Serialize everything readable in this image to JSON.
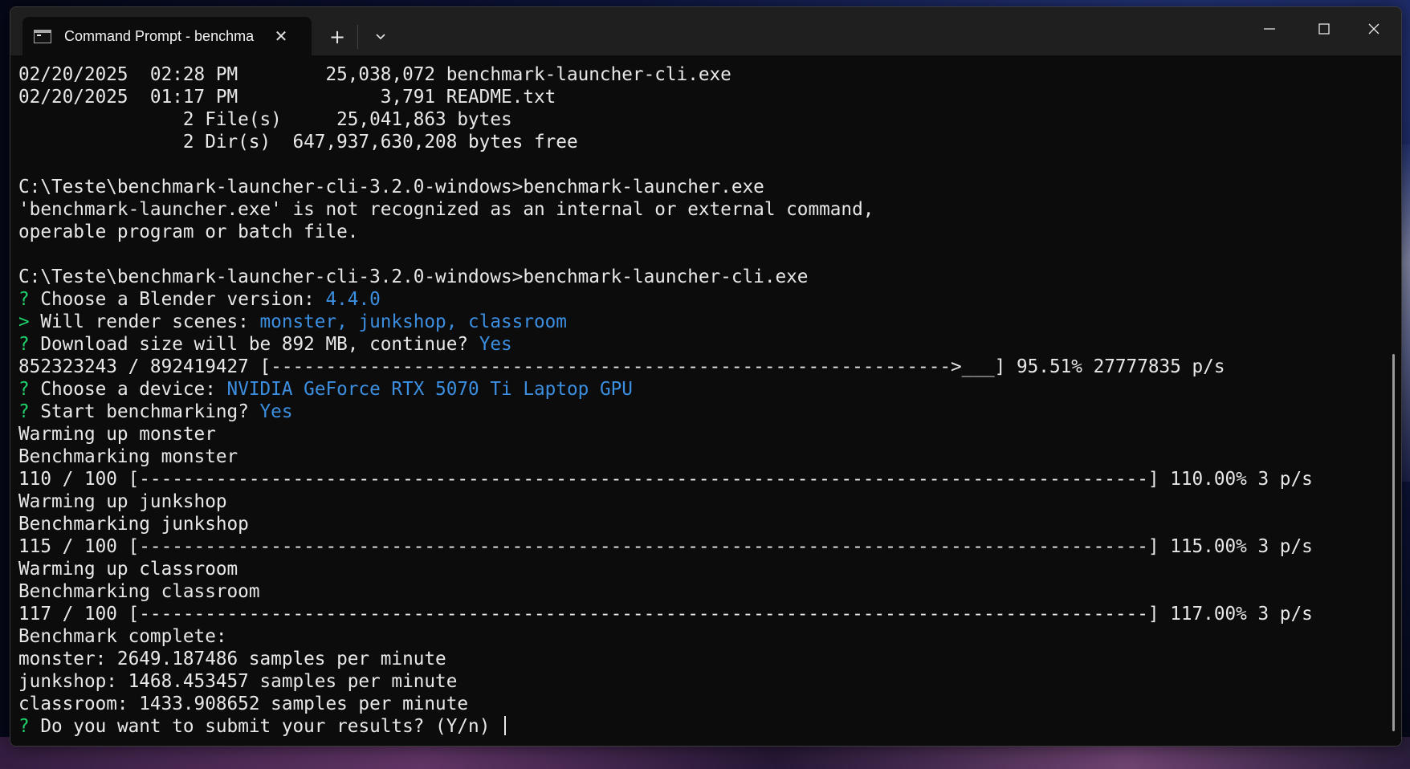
{
  "window": {
    "tab_title": "Command Prompt - benchma",
    "tab_icon": "terminal-icon",
    "close_tab_symbol": "✕",
    "new_tab_symbol": "+",
    "controls": [
      "minimize-icon",
      "maximize-icon",
      "close-icon"
    ]
  },
  "colors": {
    "prompt_green": "#1fd36a",
    "answer_blue": "#3c8fe0",
    "text": "#e8e8e8",
    "background": "#0c0c0c"
  },
  "terminal": {
    "lines": [
      {
        "t": "02/20/2025  02:28 PM        25,038,072 benchmark-launcher-cli.exe"
      },
      {
        "t": "02/20/2025  01:17 PM             3,791 README.txt"
      },
      {
        "t": "               2 File(s)     25,041,863 bytes"
      },
      {
        "t": "               2 Dir(s)  647,937,630,208 bytes free"
      },
      {
        "t": ""
      },
      {
        "t": "C:\\Teste\\benchmark-launcher-cli-3.2.0-windows>benchmark-launcher.exe"
      },
      {
        "t": "'benchmark-launcher.exe' is not recognized as an internal or external command,"
      },
      {
        "t": "operable program or batch file."
      },
      {
        "t": ""
      },
      {
        "t": "C:\\Teste\\benchmark-launcher-cli-3.2.0-windows>benchmark-launcher-cli.exe"
      },
      {
        "p": "?",
        "t": " Choose a Blender version: ",
        "a": "4.4.0"
      },
      {
        "p": ">",
        "t": " Will render scenes: ",
        "a": "monster, junkshop, classroom"
      },
      {
        "p": "?",
        "t": " Download size will be 892 MB, continue? ",
        "a": "Yes"
      },
      {
        "t": "852323243 / 892419427 [-------------------------------------------------------------->___] 95.51% 27777835 p/s"
      },
      {
        "p": "?",
        "t": " Choose a device: ",
        "a": "NVIDIA GeForce RTX 5070 Ti Laptop GPU"
      },
      {
        "p": "?",
        "t": " Start benchmarking? ",
        "a": "Yes"
      },
      {
        "t": "Warming up monster"
      },
      {
        "t": "Benchmarking monster"
      },
      {
        "t": "110 / 100 [--------------------------------------------------------------------------------------------] 110.00% 3 p/s"
      },
      {
        "t": "Warming up junkshop"
      },
      {
        "t": "Benchmarking junkshop"
      },
      {
        "t": "115 / 100 [--------------------------------------------------------------------------------------------] 115.00% 3 p/s"
      },
      {
        "t": "Warming up classroom"
      },
      {
        "t": "Benchmarking classroom"
      },
      {
        "t": "117 / 100 [--------------------------------------------------------------------------------------------] 117.00% 3 p/s"
      },
      {
        "t": "Benchmark complete:"
      },
      {
        "t": "monster: 2649.187486 samples per minute"
      },
      {
        "t": "junkshop: 1468.453457 samples per minute"
      },
      {
        "t": "classroom: 1433.908652 samples per minute"
      },
      {
        "p": "?",
        "t": " Do you want to submit your results? (Y/n) ",
        "cursor": true
      }
    ]
  }
}
